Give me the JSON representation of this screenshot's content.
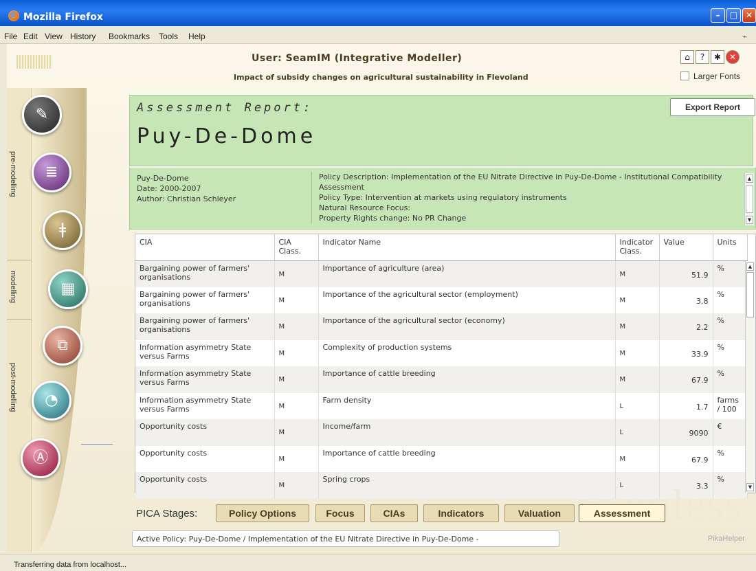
{
  "window": {
    "title": "Mozilla Firefox"
  },
  "menu": [
    "File",
    "Edit",
    "View",
    "History",
    "Bookmarks",
    "Tools",
    "Help"
  ],
  "header": {
    "user": "User: SeamIM (Integrative Modeller)",
    "subtitle": "Impact of subsidy changes on agricultural sustainability in Flevoland",
    "larger_fonts": "Larger Fonts"
  },
  "sidebar": {
    "sections": [
      "pre-modelling",
      "modelling",
      "post-modelling"
    ]
  },
  "report": {
    "label": "Assessment Report:",
    "title": "Puy-De-Dome",
    "export_button": "Export Report",
    "info": {
      "region": "Puy-De-Dome",
      "date": "Date: 2000-2007",
      "author": "Author: Christian Schleyer",
      "policy_description": "Policy Description: Implementation of the EU Nitrate Directive in Puy-De-Dome - Institutional Compatibility Assessment",
      "policy_type": "Policy Type: Intervention at markets using regulatory instruments",
      "resource_focus": "Natural Resource Focus:",
      "property_rights": "Property Rights change: No PR Change"
    }
  },
  "table": {
    "headers": [
      "CIA",
      "CIA Class.",
      "Indicator Name",
      "Indicator Class.",
      "Value",
      "Units"
    ],
    "rows": [
      {
        "cia": "Bargaining power of farmers' organisations",
        "cia_class": "M",
        "indicator": "Importance of agriculture (area)",
        "ind_class": "M",
        "value": "51.9",
        "units": "%"
      },
      {
        "cia": "Bargaining power of farmers' organisations",
        "cia_class": "M",
        "indicator": "Importance of the agricultural sector (employment)",
        "ind_class": "M",
        "value": "3.8",
        "units": "%"
      },
      {
        "cia": "Bargaining power of farmers' organisations",
        "cia_class": "M",
        "indicator": "Importance of the agricultural sector (economy)",
        "ind_class": "M",
        "value": "2.2",
        "units": "%"
      },
      {
        "cia": "Information asymmetry State versus Farms",
        "cia_class": "M",
        "indicator": "Complexity of production systems",
        "ind_class": "M",
        "value": "33.9",
        "units": "%"
      },
      {
        "cia": "Information asymmetry State versus Farms",
        "cia_class": "M",
        "indicator": "Importance of cattle breeding",
        "ind_class": "M",
        "value": "67.9",
        "units": "%"
      },
      {
        "cia": "Information asymmetry State versus Farms",
        "cia_class": "M",
        "indicator": "Farm density",
        "ind_class": "L",
        "value": "1.7",
        "units": "farms / 100"
      },
      {
        "cia": "Opportunity costs",
        "cia_class": "M",
        "indicator": "Income/farm",
        "ind_class": "L",
        "value": "9090",
        "units": "€"
      },
      {
        "cia": "Opportunity costs",
        "cia_class": "M",
        "indicator": "Importance of cattle breeding",
        "ind_class": "M",
        "value": "67.9",
        "units": "%"
      },
      {
        "cia": "Opportunity costs",
        "cia_class": "M",
        "indicator": "Spring crops",
        "ind_class": "L",
        "value": "3.3",
        "units": "%"
      }
    ]
  },
  "stages": {
    "label": "PICA Stages:",
    "items": [
      "Policy Options",
      "Focus",
      "CIAs",
      "Indicators",
      "Valuation",
      "Assessment"
    ],
    "active": "Assessment"
  },
  "active_policy": "Active Policy: Puy-De-Dome / Implementation of the EU Nitrate Directive in Puy-De-Dome -",
  "watermark": "seamless",
  "pikahelper": "PikaHelper",
  "status": "Transferring data from localhost..."
}
